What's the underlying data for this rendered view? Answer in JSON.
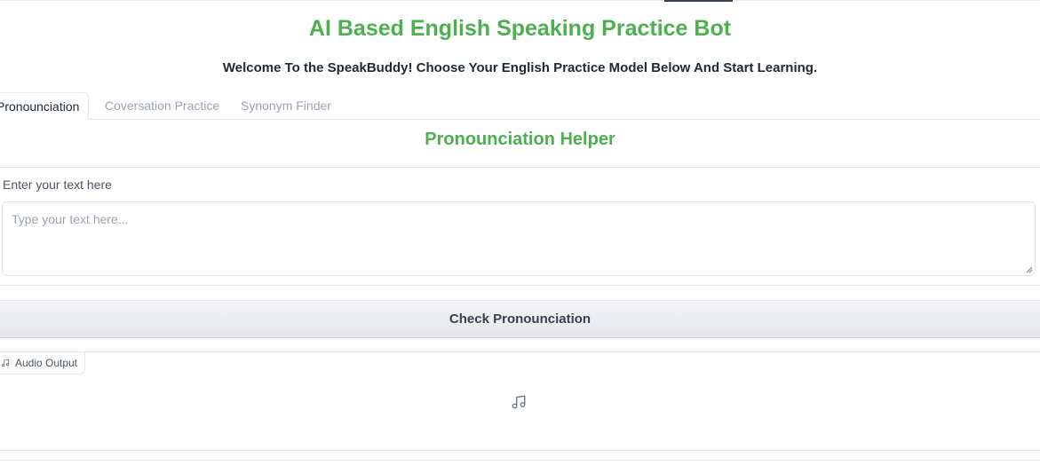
{
  "app": {
    "title": "AI Based English Speaking Practice Bot",
    "subtitle": "Welcome To the SpeakBuddy! Choose Your English Practice Model Below And Start Learning.",
    "accent_color": "#4caf50"
  },
  "tabs": [
    {
      "label": "Pronounciation",
      "active": true
    },
    {
      "label": "Coversation Practice",
      "active": false
    },
    {
      "label": "Synonym Finder",
      "active": false
    }
  ],
  "pronunciation": {
    "section_title": "Pronounciation Helper",
    "input_label": "Enter your text here",
    "input_placeholder": "Type your text here...",
    "input_value": "",
    "button_label": "Check Pronounciation",
    "audio_label": "Audio Output",
    "audio_icon": "music-note-icon"
  }
}
